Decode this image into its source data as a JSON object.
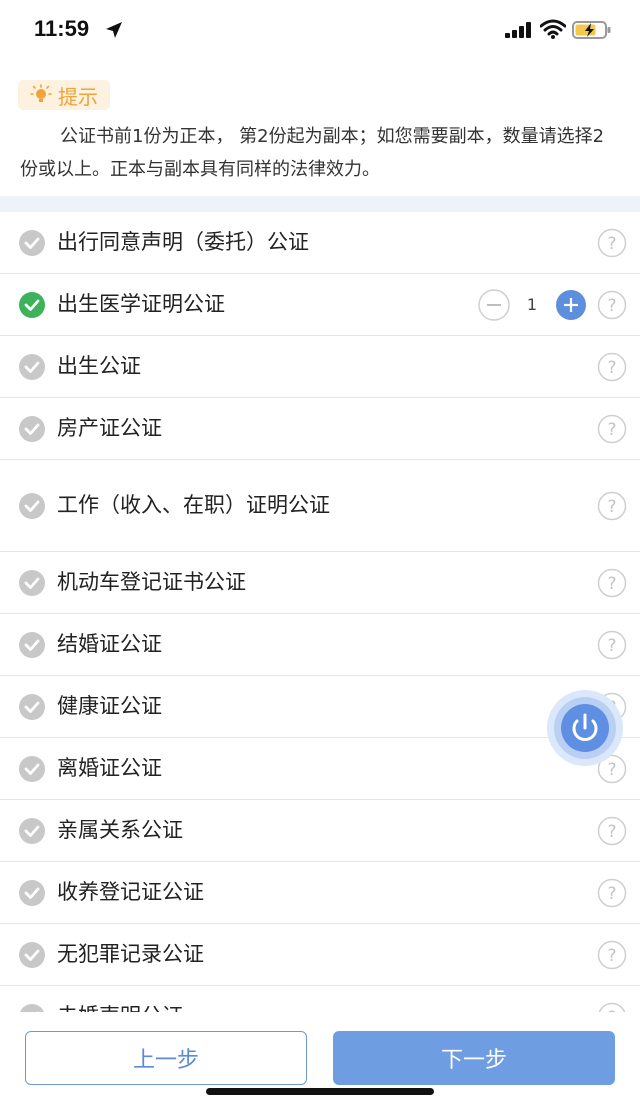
{
  "status_bar": {
    "time": "11:59",
    "icons": [
      "location-arrow-icon",
      "cellular-signal-icon",
      "wifi-icon",
      "battery-charging-icon"
    ]
  },
  "tip": {
    "label": "提示",
    "text": "公证书前1份为正本， 第2份起为副本；如您需要副本，数量请选择2份或以上。正本与副本具有同样的法律效力。",
    "accent_color": "#f0a33a"
  },
  "items": [
    {
      "label": "出行同意声明（委托）公证",
      "checked": false
    },
    {
      "label": "出生医学证明公证",
      "checked": true,
      "quantity": "1"
    },
    {
      "label": "出生公证",
      "checked": false
    },
    {
      "label": "房产证公证",
      "checked": false
    },
    {
      "label": "工作（收入、在职）证明公证",
      "checked": false
    },
    {
      "label": "机动车登记证书公证",
      "checked": false
    },
    {
      "label": "结婚证公证",
      "checked": false
    },
    {
      "label": "健康证公证",
      "checked": false
    },
    {
      "label": "离婚证公证",
      "checked": false
    },
    {
      "label": "亲属关系公证",
      "checked": false
    },
    {
      "label": "收养登记证公证",
      "checked": false
    },
    {
      "label": "无犯罪记录公证",
      "checked": false
    },
    {
      "label": "未婚声明公证",
      "checked": false
    }
  ],
  "buttons": {
    "prev": "上一步",
    "next": "下一步"
  },
  "colors": {
    "checked": "#3cb35a",
    "unchecked": "#c8c8c8",
    "primary": "#6f9de2"
  }
}
